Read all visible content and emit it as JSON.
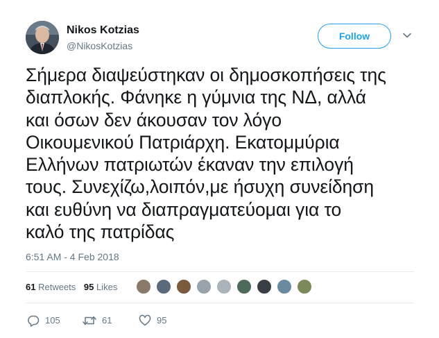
{
  "author": {
    "name": "Nikos Kotzias",
    "handle": "@NikosKotzias"
  },
  "follow_label": "Follow",
  "tweet": {
    "text": "Σήμερα διαψεύστηκαν οι δημοσκοπήσεις της\nδιαπλοκής. Φάνηκε η γύμνια της ΝΔ, αλλά\nκαι όσων δεν άκουσαν τον λόγο\nΟικουμενικού Πατριάρχη. Εκατομμύρια\nΕλλήνων πατριωτών έκαναν την επιλογή\nτους. Συνεχίζω,λοιπόν,με ήσυχη συνείδηση\nκαι ευθύνη να διαπραγματεύομαι για το\nκαλό της πατρίδας",
    "timestamp": "6:51 AM - 4 Feb 2018"
  },
  "stats": {
    "retweets_count": "61",
    "retweets_label": "Retweets",
    "likes_count": "95",
    "likes_label": "Likes"
  },
  "likers": [
    "#8a7a6a",
    "#5a6a7a",
    "#7b5a3e",
    "#9aa3ab",
    "#aab2ba",
    "#4e6a5a",
    "#3a3f46",
    "#6a8aa0",
    "#7a8a5a"
  ],
  "actions": {
    "replies": "105",
    "retweets": "61",
    "likes": "95"
  },
  "colors": {
    "accent": "#1da1f2",
    "secondary_text": "#657786",
    "divider": "#e6ecf0"
  }
}
